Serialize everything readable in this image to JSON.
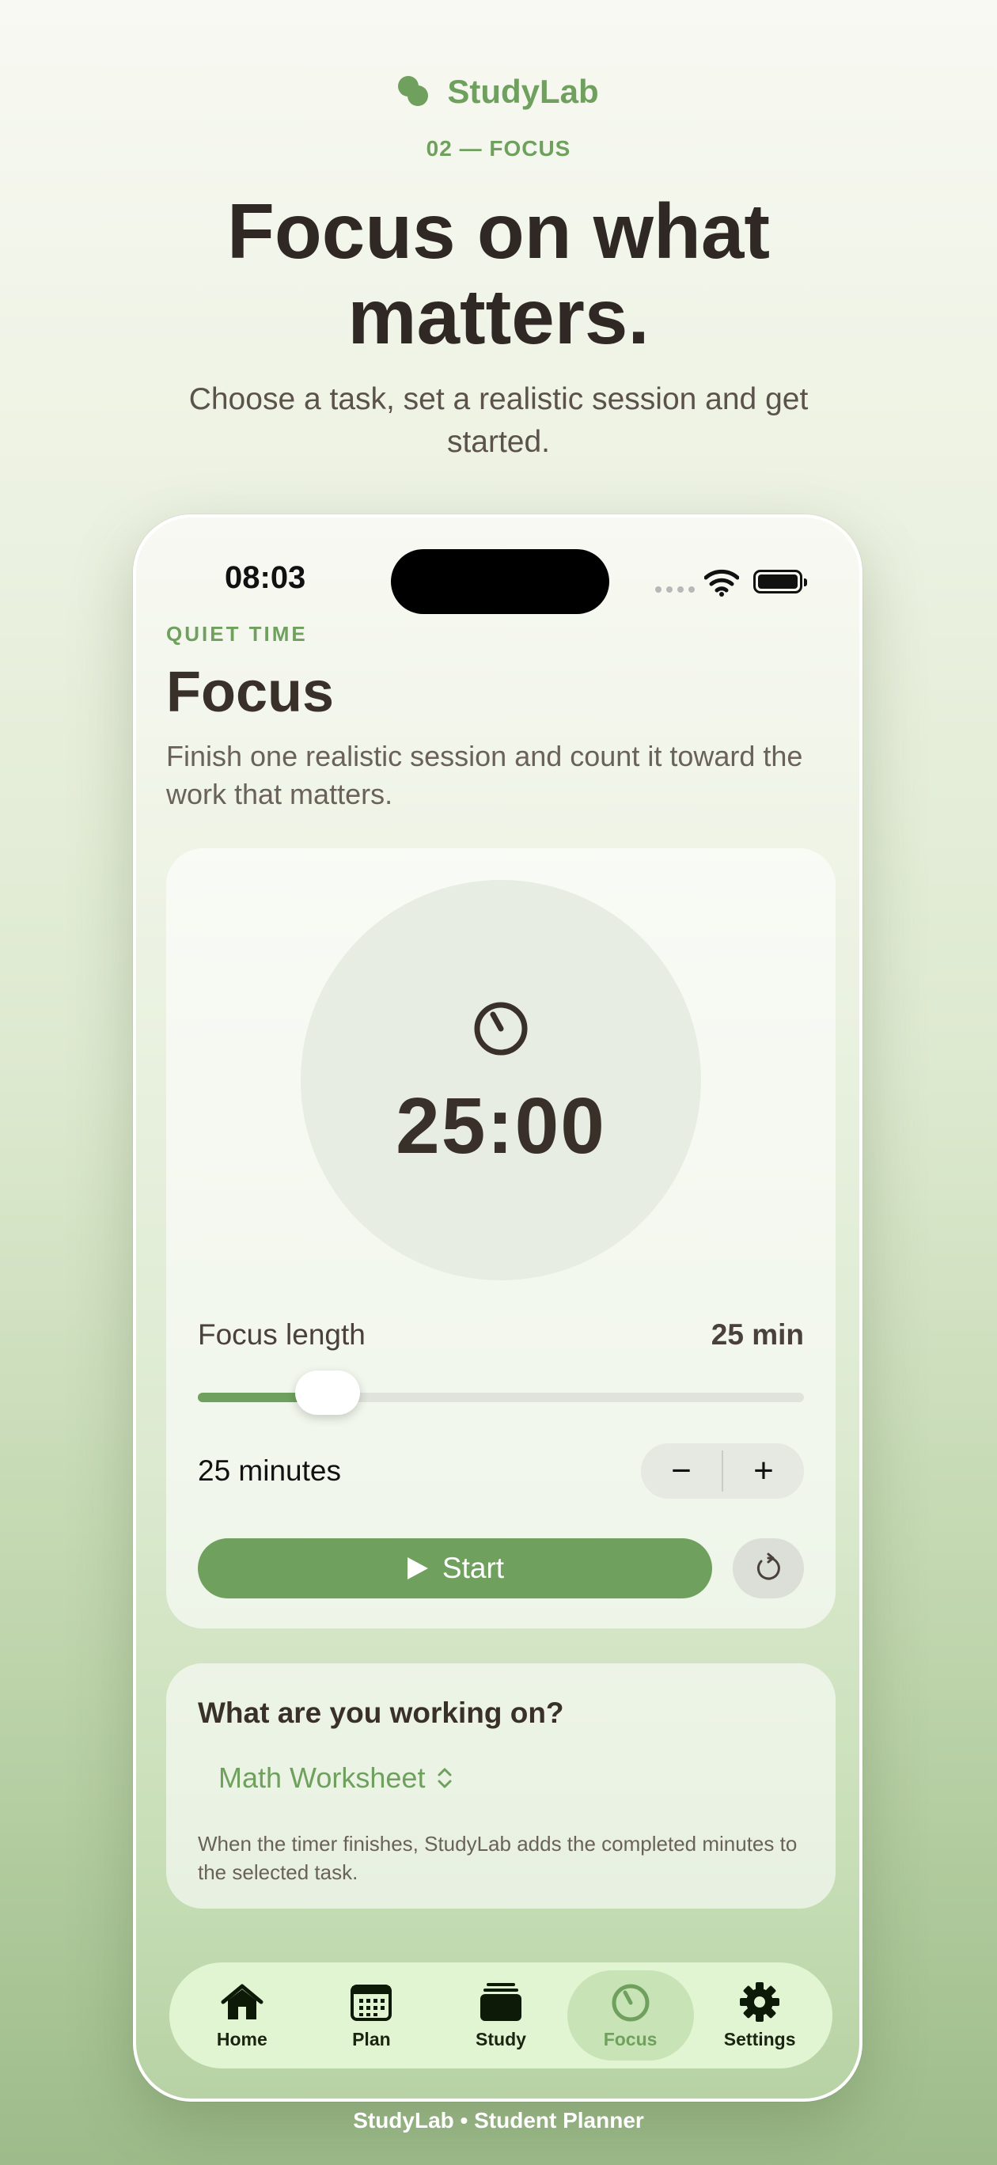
{
  "brand": {
    "name": "StudyLab",
    "logo_icon": "studylab-logo-icon"
  },
  "page": {
    "eyebrow": "02 — FOCUS",
    "headline": "Focus on what matters.",
    "subhead": "Choose a task, set a realistic session and get started."
  },
  "status_bar": {
    "time": "08:03"
  },
  "screen": {
    "kicker": "QUIET TIME",
    "title": "Focus",
    "description": "Finish one realistic session and count it toward the work that matters."
  },
  "timer": {
    "display": "25:00",
    "icon": "timer-icon",
    "length_label": "Focus length",
    "length_value": "25 min",
    "slider_fraction": 0.18,
    "minutes_label": "25 minutes",
    "decrement_label": "−",
    "increment_label": "+",
    "start_label": "Start",
    "reset_icon": "reset-icon"
  },
  "task": {
    "question": "What are you working on?",
    "selected": "Math Worksheet",
    "note": "When the timer finishes, StudyLab adds the completed minutes to the selected task."
  },
  "tabbar": {
    "items": [
      {
        "label": "Home",
        "icon": "home-icon"
      },
      {
        "label": "Plan",
        "icon": "calendar-icon"
      },
      {
        "label": "Study",
        "icon": "stack-icon"
      },
      {
        "label": "Focus",
        "icon": "timer-icon",
        "active": true
      },
      {
        "label": "Settings",
        "icon": "gear-icon"
      }
    ]
  },
  "footer": {
    "text": "StudyLab  •  Student Planner"
  },
  "colors": {
    "accent": "#6fa05e",
    "text": "#3a302a",
    "tab_bg": "#e2f5d3",
    "tab_active": "#c8e3b6"
  }
}
